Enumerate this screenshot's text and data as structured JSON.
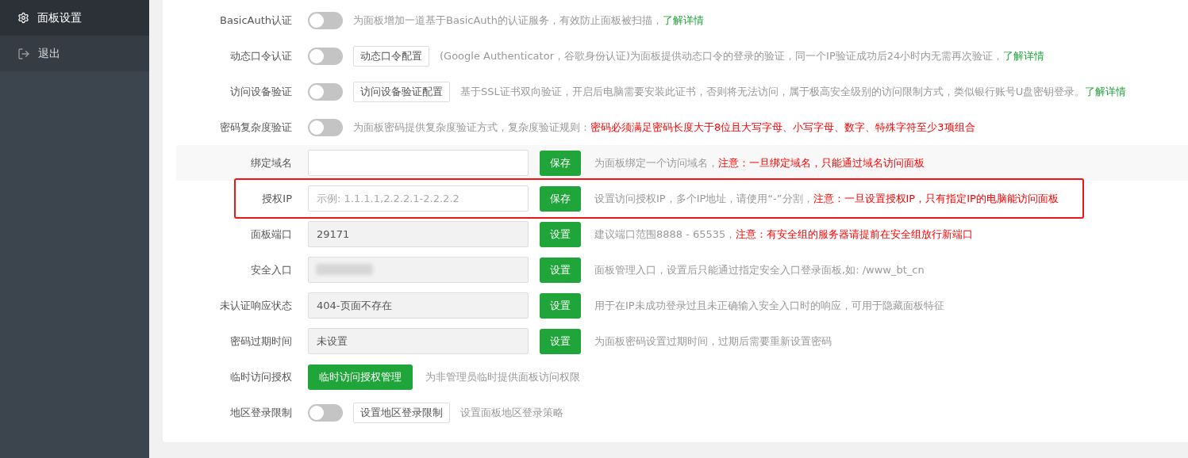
{
  "sidebar": {
    "items": [
      {
        "label": "面板设置",
        "selected": true
      },
      {
        "label": "退出",
        "selected": false
      }
    ]
  },
  "settings": [
    {
      "kind": "toggle",
      "label": "BasicAuth认证",
      "on": false,
      "description": [
        {
          "kind": "plain",
          "text": "为面板增加一道基于BasicAuth的认证服务，有效防止面板被扫描，"
        },
        {
          "kind": "link",
          "text": "了解详情"
        }
      ]
    },
    {
      "kind": "toggle",
      "label": "动态口令认证",
      "on": false,
      "config_button": "动态口令配置",
      "description": [
        {
          "kind": "plain",
          "text": "(Google Authenticator，谷歌身份认证)为面板提供动态口令的登录的验证，同一个IP验证成功后24小时内无需再次验证，"
        },
        {
          "kind": "link",
          "text": "了解详情"
        }
      ]
    },
    {
      "kind": "toggle",
      "label": "访问设备验证",
      "on": false,
      "config_button": "访问设备验证配置",
      "description": [
        {
          "kind": "plain",
          "text": "基于SSL证书双向验证，开启后电脑需要安装此证书，否则将无法访问，属于极高安全级别的访问限制方式，类似银行账号U盘密钥登录。"
        },
        {
          "kind": "link",
          "text": "了解详情"
        }
      ]
    },
    {
      "kind": "toggle",
      "label": "密码复杂度验证",
      "on": false,
      "description": [
        {
          "kind": "plain",
          "text": "为面板密码提供复杂度验证方式，复杂度验证规则："
        },
        {
          "kind": "warning",
          "text": "密码必须满足密码长度大于8位且大写字母、小写字母、数字、特殊字符至少3项组合"
        }
      ]
    },
    {
      "kind": "input",
      "label": "绑定域名",
      "hovered": true,
      "disabled": false,
      "button": "保存",
      "description": [
        {
          "kind": "plain",
          "text": "为面板绑定一个访问域名，"
        },
        {
          "kind": "warning",
          "text": "注意：一旦绑定域名，只能通过域名访问面板"
        }
      ]
    },
    {
      "kind": "input",
      "label": "授权IP",
      "highlighted": true,
      "disabled": false,
      "placeholder": "示例: 1.1.1.1,2.2.2.1-2.2.2.2",
      "button": "保存",
      "description": [
        {
          "kind": "plain",
          "text": "设置访问授权IP，多个IP地址，请使用“-”分割，"
        },
        {
          "kind": "warning",
          "text": "注意：一旦设置授权IP，只有指定IP的电脑能访问面板"
        }
      ]
    },
    {
      "kind": "input",
      "label": "面板端口",
      "disabled": true,
      "value": "29171",
      "button": "设置",
      "description": [
        {
          "kind": "plain",
          "text": "建议端口范围8888 - 65535，"
        },
        {
          "kind": "warning",
          "text": "注意：有安全组的服务器请提前在安全组放行新端口"
        }
      ]
    },
    {
      "kind": "input",
      "label": "安全入口",
      "disabled": true,
      "redacted": true,
      "button": "设置",
      "description": [
        {
          "kind": "plain",
          "text": "面板管理入口，设置后只能通过指定安全入口登录面板,如: /www_bt_cn"
        }
      ]
    },
    {
      "kind": "input",
      "label": "未认证响应状态",
      "disabled": true,
      "value": "404-页面不存在",
      "button": "设置",
      "description": [
        {
          "kind": "plain",
          "text": "用于在IP未成功登录过且未正确输入安全入口时的响应，可用于隐藏面板特征"
        }
      ]
    },
    {
      "kind": "input",
      "label": "密码过期时间",
      "disabled": true,
      "value": "未设置",
      "button": "设置",
      "description": [
        {
          "kind": "plain",
          "text": "为面板密码设置过期时间，过期后需要重新设置密码"
        }
      ]
    },
    {
      "kind": "action",
      "label": "临时访问授权",
      "button": "临时访问授权管理",
      "description": [
        {
          "kind": "plain",
          "text": "为非管理员临时提供面板访问权限"
        }
      ]
    },
    {
      "kind": "toggle",
      "label": "地区登录限制",
      "on": false,
      "config_button": "设置地区登录限制",
      "description": [
        {
          "kind": "plain",
          "text": "设置面板地区登录策略"
        }
      ]
    }
  ]
}
